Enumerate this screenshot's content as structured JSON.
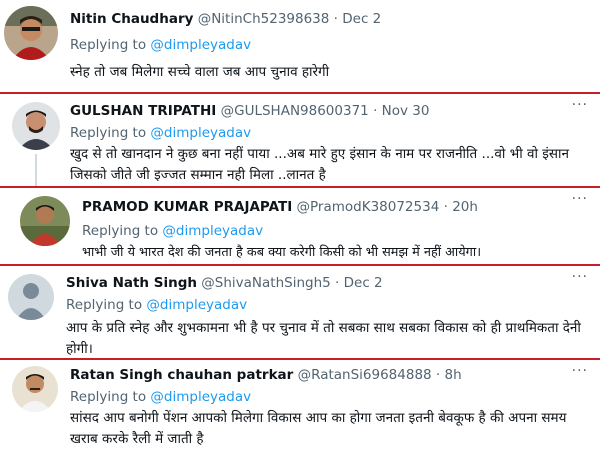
{
  "tweets": [
    {
      "name": "Nitin Chaudhary",
      "handle": "@NitinCh52398638",
      "separator": "·",
      "time": "Dec 2",
      "replying_prefix": "Replying to",
      "replying_to": "@dimpleyadav",
      "text": "स्नेह तो जब मिलेगा सच्चे वाला जब आप चुनाव हारेगी"
    },
    {
      "name": "GULSHAN TRIPATHI",
      "handle": "@GULSHAN98600371",
      "separator": "·",
      "time": "Nov 30",
      "replying_prefix": "Replying to",
      "replying_to": "@dimpleyadav",
      "text": "खुद से तो खानदान ने कुछ बना नहीं पाया ...अब मारे हुए इंसान के नाम पर राजनीति ...वो भी वो इंसान जिसको जीते जी इज्जत सम्मान नही मिला ..लानत है"
    },
    {
      "name": "PRAMOD KUMAR PRAJAPATI",
      "handle": "@PramodK38072534",
      "separator": "·",
      "time": "20h",
      "replying_prefix": "Replying to",
      "replying_to": "@dimpleyadav",
      "text": "भाभी जी ये भारत देश की जनता है कब क्या करेगी किसी को भी समझ में नहीं आयेगा।"
    },
    {
      "name": "Shiva Nath Singh",
      "handle": "@ShivaNathSingh5",
      "separator": "·",
      "time": "Dec 2",
      "replying_prefix": "Replying to",
      "replying_to": "@dimpleyadav",
      "text": "आप के प्रति स्नेह और शुभकामना भी है पर चुनाव में तो सबका साथ सबका विकास को ही प्राथमिकता देनी होगी।"
    },
    {
      "name": "Ratan Singh chauhan patrkar",
      "handle": "@RatanSi69684888",
      "separator": "·",
      "time": "8h",
      "replying_prefix": "Replying to",
      "replying_to": "@dimpleyadav",
      "text": "सांसद आप बनोगी पेंशन आपको मिलेगा विकास आप का होगा जनता इतनी बेवकूफ है की अपना समय खराब करके रैली में जाती है"
    }
  ],
  "more_icon": "···",
  "colors": {
    "divider": "#c81e28",
    "mention": "#1d9bf0",
    "muted": "#536471",
    "text": "#0f1419"
  }
}
